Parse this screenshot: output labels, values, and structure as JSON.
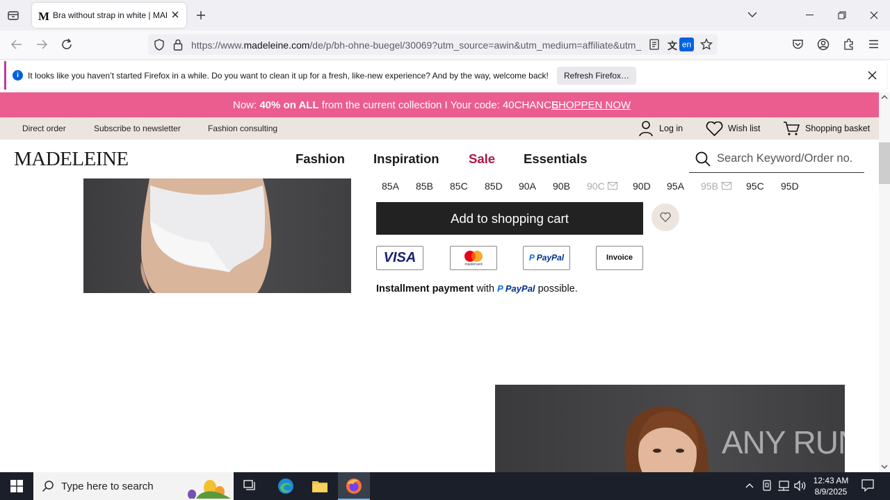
{
  "browser": {
    "tab_title": "Bra without strap in white | MADELEINE",
    "url_prefix": "https://www.",
    "url_domain": "madeleine.com",
    "url_rest": "/de/p/bh-ohne-buegel/30069?utm_source=awin&utm_medium=affiliate&utm_campaign",
    "translate_badge": "en"
  },
  "notification": {
    "text": "It looks like you haven’t started Firefox in a while. Do you want to clean it up for a fresh, like-new experience? And by the way, welcome back!",
    "button": "Refresh Firefox…"
  },
  "promo": {
    "prefix": "Now: ",
    "bold": "40% on ALL",
    "suffix": " from the current collection I Your code: 40CHANCE",
    "link": "SHOPPEN NOW",
    "color": "#ec5d8f"
  },
  "service": {
    "direct_order": "Direct order",
    "newsletter": "Subscribe to newsletter",
    "consulting": "Fashion consulting",
    "login": "Log in",
    "wishlist": "Wish list",
    "basket": "Shopping basket"
  },
  "header": {
    "logo": "MADELEINE",
    "nav": [
      "Fashion",
      "Inspiration",
      "Sale",
      "Essentials"
    ],
    "sale_color": "#b0124c",
    "search_placeholder": "Search Keyword/Order no."
  },
  "product": {
    "sizes": [
      {
        "label": "85A",
        "available": true
      },
      {
        "label": "85B",
        "available": true
      },
      {
        "label": "85C",
        "available": true
      },
      {
        "label": "85D",
        "available": true
      },
      {
        "label": "90A",
        "available": true
      },
      {
        "label": "90B",
        "available": true
      },
      {
        "label": "90C",
        "available": false
      },
      {
        "label": "90D",
        "available": true
      },
      {
        "label": "95A",
        "available": true
      },
      {
        "label": "95B",
        "available": false
      },
      {
        "label": "95C",
        "available": true
      },
      {
        "label": "95D",
        "available": true
      }
    ],
    "add_to_cart": "Add to shopping cart",
    "payments": {
      "visa": "VISA",
      "mastercard": "mastercard",
      "paypal": "PayPal",
      "invoice": "Invoice"
    },
    "installment_bold": "Installment payment",
    "installment_with": " with",
    "installment_paypal": "PayPal",
    "installment_end": " possible."
  },
  "taskbar": {
    "search_placeholder": "Type here to search",
    "time": "12:43 AM",
    "date": "8/9/2025",
    "watermark": "ANY RUN"
  }
}
